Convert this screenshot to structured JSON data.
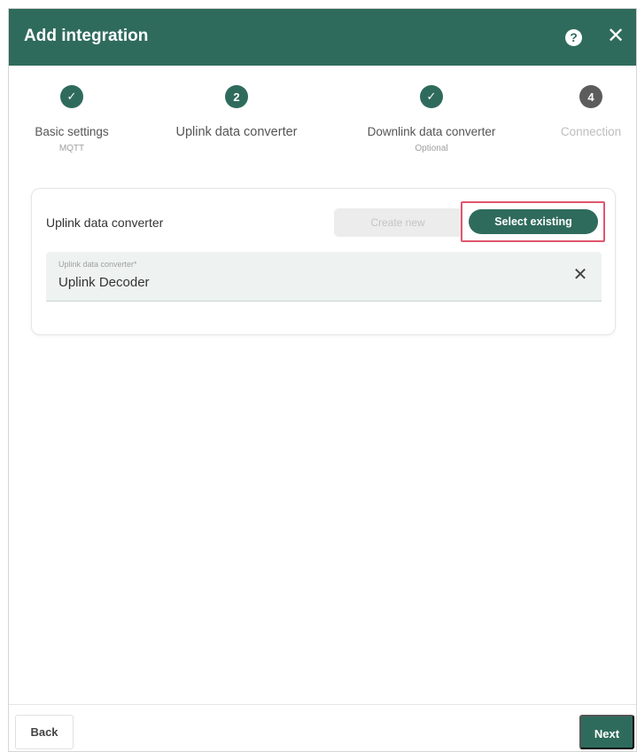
{
  "dialog": {
    "title": "Add integration",
    "help_icon": "help-circle-icon",
    "close_icon": "close-icon"
  },
  "stepper": {
    "steps": [
      {
        "label": "Basic settings",
        "sublabel": "MQTT",
        "state": "completed",
        "marker": "check-icon",
        "marker_text": "✓"
      },
      {
        "label": "Uplink data converter",
        "sublabel": "",
        "state": "active",
        "marker": "step-number",
        "marker_text": "2"
      },
      {
        "label": "Downlink data converter",
        "sublabel": "Optional",
        "state": "completed",
        "marker": "check-icon",
        "marker_text": "✓"
      },
      {
        "label": "Connection",
        "sublabel": "",
        "state": "disabled",
        "marker": "step-number",
        "marker_text": "4"
      }
    ]
  },
  "converter": {
    "title": "Uplink data converter",
    "create_new_label": "Create new",
    "select_existing_label": "Select existing",
    "field_label": "Uplink data converter*",
    "field_value": "Uplink Decoder",
    "clear_icon": "clear-icon"
  },
  "footer": {
    "back_label": "Back",
    "next_label": "Next"
  },
  "colors": {
    "primary": "#2f6b5c",
    "highlight": "#e0566e",
    "disabled_step": "#5c5c5c"
  }
}
